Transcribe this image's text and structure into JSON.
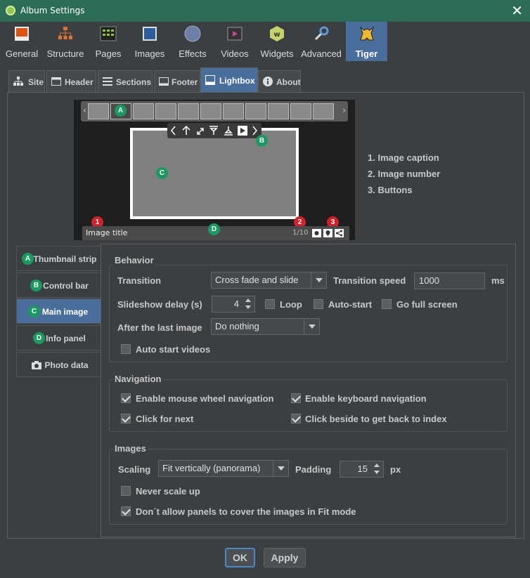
{
  "window": {
    "title": "Album Settings"
  },
  "toolbar": [
    {
      "label": "General",
      "icon": "general-icon"
    },
    {
      "label": "Structure",
      "icon": "structure-icon"
    },
    {
      "label": "Pages",
      "icon": "pages-icon"
    },
    {
      "label": "Images",
      "icon": "images-icon"
    },
    {
      "label": "Effects",
      "icon": "effects-icon"
    },
    {
      "label": "Videos",
      "icon": "videos-icon"
    },
    {
      "label": "Widgets",
      "icon": "widgets-icon"
    },
    {
      "label": "Advanced",
      "icon": "advanced-icon"
    },
    {
      "label": "Tiger",
      "icon": "tiger-icon",
      "selected": true
    }
  ],
  "subtabs": [
    {
      "label": "Site"
    },
    {
      "label": "Header"
    },
    {
      "label": "Sections"
    },
    {
      "label": "Footer"
    },
    {
      "label": "Lightbox",
      "selected": true
    },
    {
      "label": "About"
    }
  ],
  "preview": {
    "badges": [
      "A",
      "B",
      "C",
      "D",
      "1",
      "2",
      "3"
    ],
    "image_title": "Image title",
    "image_number": "1/10"
  },
  "legend": [
    "1. Image caption",
    "2. Image number",
    "3. Buttons"
  ],
  "side_tabs": [
    {
      "badge": "A",
      "label": "Thumbnail strip"
    },
    {
      "badge": "B",
      "label": "Control bar"
    },
    {
      "badge": "C",
      "label": "Main image",
      "selected": true
    },
    {
      "badge": "D",
      "label": "Info panel"
    },
    {
      "badge": "",
      "label": "Photo data"
    }
  ],
  "behavior": {
    "title": "Behavior",
    "transition_label": "Transition",
    "transition_value": "Cross fade and slide",
    "speed_label": "Transition speed",
    "speed_value": "1000",
    "speed_unit": "ms",
    "delay_label": "Slideshow delay (s)",
    "delay_value": "4",
    "loop_label": "Loop",
    "autostart_label": "Auto-start",
    "fullscreen_label": "Go full screen",
    "after_label": "After the last image",
    "after_value": "Do nothing",
    "autovideo_label": "Auto start videos"
  },
  "navigation": {
    "title": "Navigation",
    "wheel_label": "Enable mouse wheel navigation",
    "keyboard_label": "Enable keyboard navigation",
    "click_next_label": "Click for next",
    "click_beside_label": "Click beside to get back to index"
  },
  "images": {
    "title": "Images",
    "scaling_label": "Scaling",
    "scaling_value": "Fit vertically (panorama)",
    "padding_label": "Padding",
    "padding_value": "15",
    "padding_unit": "px",
    "never_scale_label": "Never scale up",
    "panels_label": "Don´t allow panels to cover the images in Fit mode"
  },
  "buttons": {
    "ok": "OK",
    "apply": "Apply"
  },
  "colors": {
    "titlebar": "#2d6d58",
    "selected": "#4a6e9c",
    "badge_green": "#1a9a60",
    "badge_red": "#d0202a"
  }
}
